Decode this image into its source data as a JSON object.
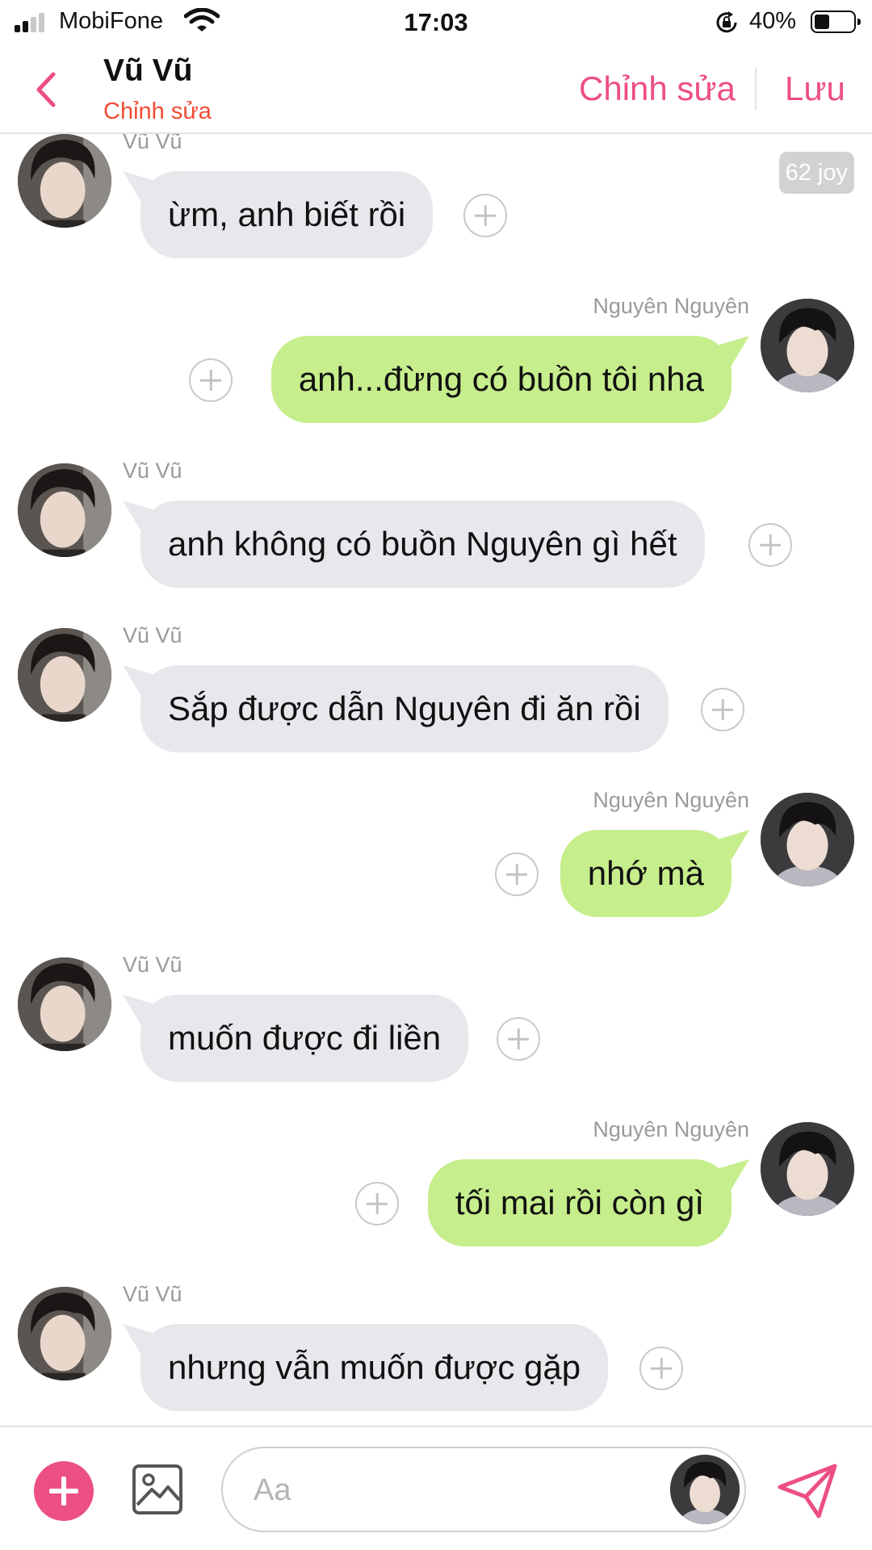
{
  "status_bar": {
    "carrier": "MobiFone",
    "time": "17:03",
    "battery": "40%",
    "battery_level": 0.4
  },
  "header": {
    "contact_name": "Vũ Vũ",
    "subtitle": "Chỉnh sửa",
    "edit_label": "Chỉnh sửa",
    "save_label": "Lưu"
  },
  "badge": {
    "joy": "62 joy"
  },
  "messages": [
    {
      "direction": "in",
      "sender": "Vũ Vũ",
      "text": "ừm, anh biết rồi"
    },
    {
      "direction": "out",
      "sender": "Nguyên Nguyên",
      "text": "anh...đừng có buồn tôi nha"
    },
    {
      "direction": "in",
      "sender": "Vũ Vũ",
      "text": "anh không có buồn Nguyên gì hết"
    },
    {
      "direction": "in",
      "sender": "Vũ Vũ",
      "text": "Sắp được dẫn Nguyên đi ăn rồi"
    },
    {
      "direction": "out",
      "sender": "Nguyên Nguyên",
      "text": "nhớ mà"
    },
    {
      "direction": "in",
      "sender": "Vũ Vũ",
      "text": "muốn được đi liền"
    },
    {
      "direction": "out",
      "sender": "Nguyên Nguyên",
      "text": "tối mai rồi còn gì"
    },
    {
      "direction": "in",
      "sender": "Vũ Vũ",
      "text": "nhưng vẫn muốn được gặp"
    }
  ],
  "composer": {
    "placeholder": "Aa"
  },
  "colors": {
    "accent": "#ec4f83",
    "subtitle": "#ef4b32",
    "bubble_in": "#e6e8ec",
    "bubble_out": "#c6ee8c"
  },
  "icons": {
    "back": "chevron-left-icon",
    "add": "plus-circle-icon",
    "gallery": "image-icon",
    "send": "paper-plane-icon",
    "bubble_action": "plus-outline-icon"
  }
}
